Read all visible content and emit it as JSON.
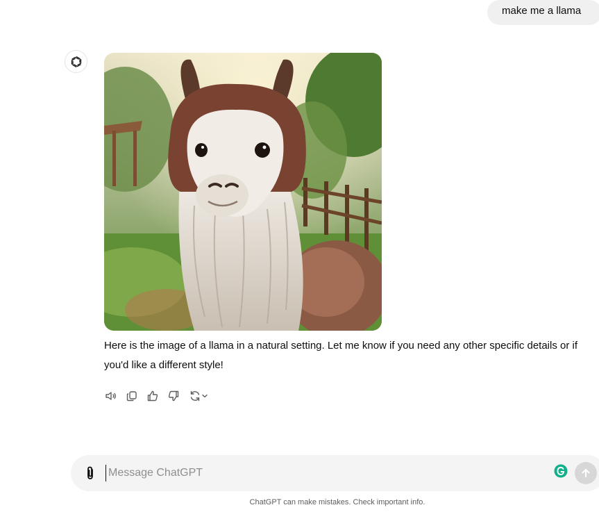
{
  "conversation": {
    "user_message": "make me a llama",
    "assistant_reply": "Here is the image of a llama in a natural setting. Let me know if you need any other specific details or if you'd like a different style!"
  },
  "assistant": {
    "avatar_icon": "openai-logo-icon"
  },
  "image": {
    "subject": "llama"
  },
  "actions": [
    {
      "name": "read-aloud",
      "icon": "speaker-icon"
    },
    {
      "name": "copy",
      "icon": "copy-icon"
    },
    {
      "name": "good-response",
      "icon": "thumbs-up-icon"
    },
    {
      "name": "bad-response",
      "icon": "thumbs-down-icon"
    },
    {
      "name": "regenerate",
      "icon": "refresh-icon"
    }
  ],
  "composer": {
    "placeholder": "Message ChatGPT",
    "value": "",
    "attach_icon": "paperclip-icon",
    "send_icon": "arrow-up-icon",
    "extension_icon": "grammarly-icon"
  },
  "footer": {
    "disclaimer": "ChatGPT can make mistakes. Check important info."
  },
  "colors": {
    "user_bubble": "#f0f0f0",
    "composer_bg": "#f4f4f4",
    "send_disabled": "#d7d7d7",
    "grammarly": "#15c39a"
  }
}
